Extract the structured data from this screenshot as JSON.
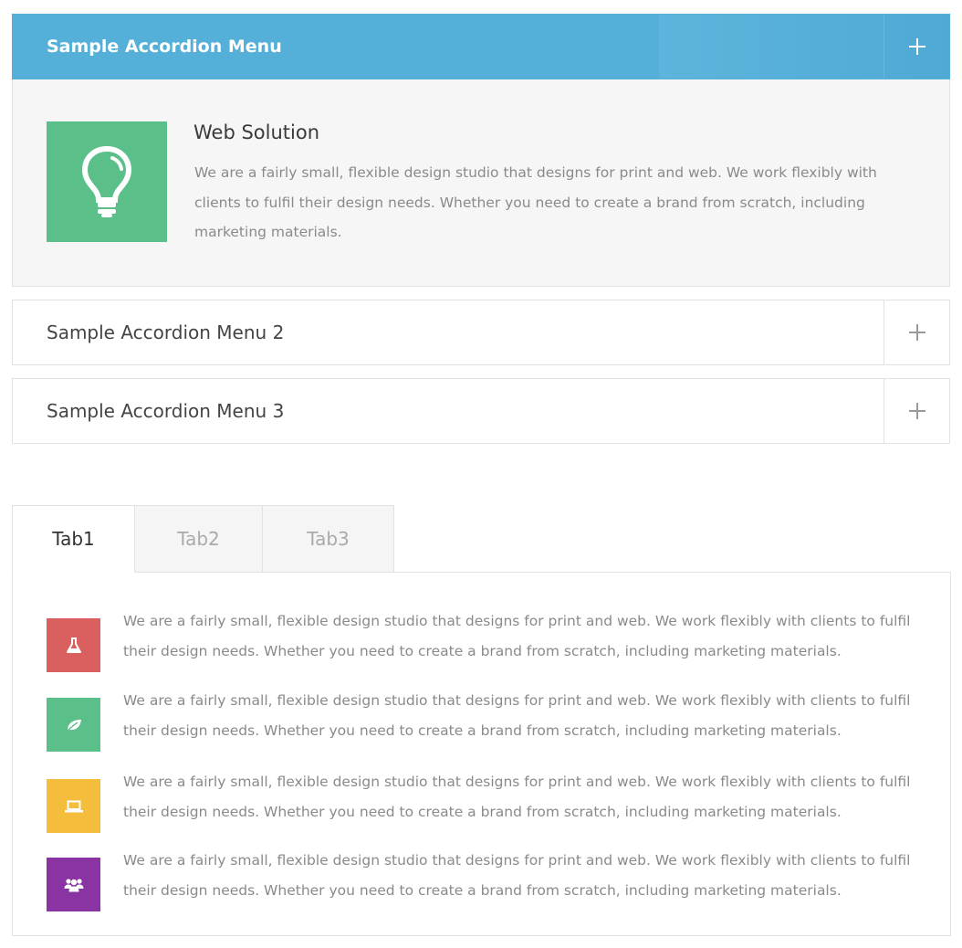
{
  "accordion": [
    {
      "title": "Sample Accordion Menu",
      "open": true,
      "feature": {
        "icon": "lightbulb-icon",
        "title": "Web Solution",
        "text": "We are a fairly small, flexible design studio that designs for print and web. We work flexibly with clients to fulfil their design needs. Whether you need to create a brand from scratch, including marketing materials."
      }
    },
    {
      "title": "Sample Accordion Menu 2",
      "open": false
    },
    {
      "title": "Sample Accordion Menu 3",
      "open": false
    }
  ],
  "tabs": {
    "labels": [
      "Tab1",
      "Tab2",
      "Tab3"
    ],
    "active": "Tab1",
    "items": [
      {
        "icon": "flask-icon",
        "color": "#d9605e",
        "text": "We are a fairly small, flexible design studio that designs for print and web. We work flexibly with clients to fulfil their design needs. Whether you need to create a brand from scratch, including marketing materials."
      },
      {
        "icon": "leaf-icon",
        "color": "#5bbf89",
        "text": "We are a fairly small, flexible design studio that designs for print and web. We work flexibly with clients to fulfil their design needs. Whether you need to create a brand from scratch, including marketing materials."
      },
      {
        "icon": "laptop-icon",
        "color": "#f5bd3c",
        "text": "We are a fairly small, flexible design studio that designs for print and web. We work flexibly with clients to fulfil their design needs. Whether you need to create a brand from scratch, including marketing materials."
      },
      {
        "icon": "users-icon",
        "color": "#8a34a3",
        "text": "We are a fairly small, flexible design studio that designs for print and web. We work flexibly with clients to fulfil their design needs. Whether you need to create a brand from scratch, including marketing materials."
      }
    ]
  },
  "colors": {
    "accent": "#55b0d9",
    "feature_green": "#5bbf89"
  }
}
